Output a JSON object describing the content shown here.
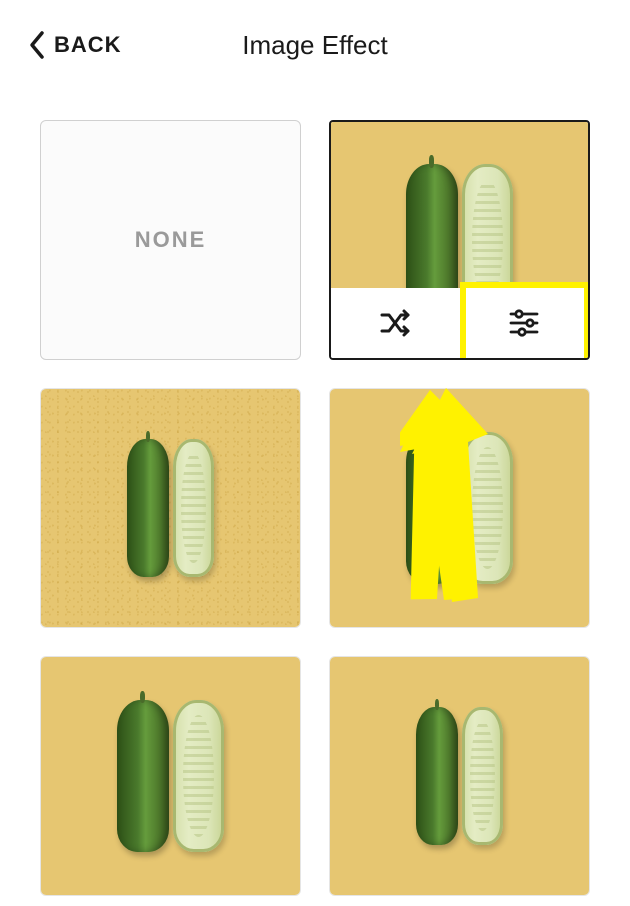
{
  "header": {
    "back_label": "BACK",
    "title": "Image Effect"
  },
  "tiles": {
    "none_label": "NONE"
  },
  "colors": {
    "highlight": "#fff200",
    "tile_bg": "#e6c671"
  }
}
